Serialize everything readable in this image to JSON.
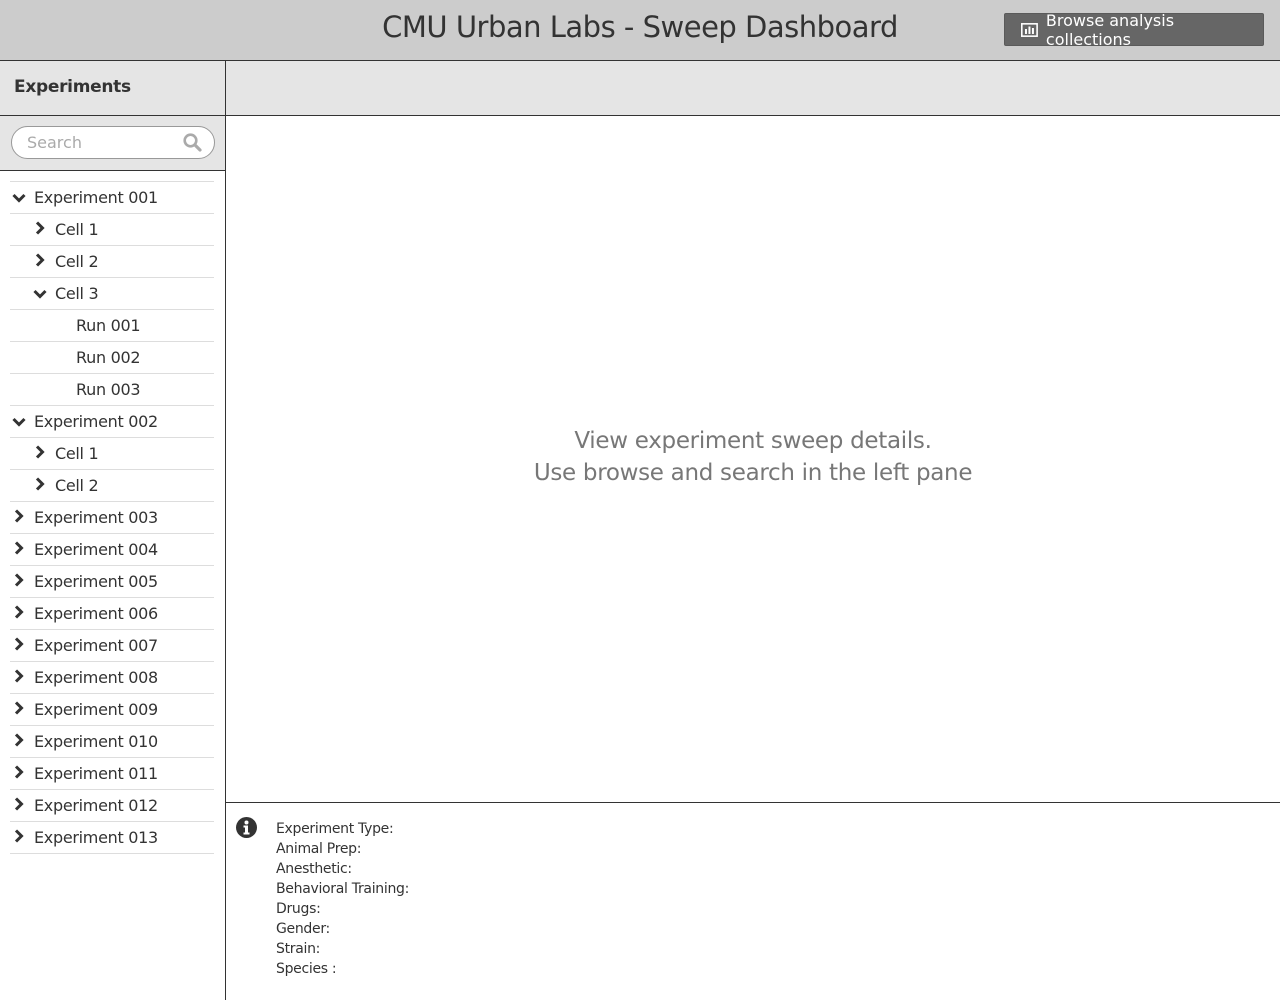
{
  "header": {
    "title": "CMU Urban Labs - Sweep Dashboard",
    "browse_label": "Browse analysis collections"
  },
  "sidebar": {
    "title": "Experiments",
    "search_placeholder": "Search",
    "tree": [
      {
        "label": "Experiment 001",
        "level": 0,
        "state": "expanded"
      },
      {
        "label": "Cell 1",
        "level": 1,
        "state": "collapsed"
      },
      {
        "label": "Cell 2",
        "level": 1,
        "state": "collapsed"
      },
      {
        "label": "Cell 3",
        "level": 1,
        "state": "expanded"
      },
      {
        "label": "Run 001",
        "level": 2,
        "state": "leaf"
      },
      {
        "label": "Run 002",
        "level": 2,
        "state": "leaf"
      },
      {
        "label": "Run 003",
        "level": 2,
        "state": "leaf"
      },
      {
        "label": "Experiment 002",
        "level": 0,
        "state": "expanded"
      },
      {
        "label": "Cell 1",
        "level": 1,
        "state": "collapsed"
      },
      {
        "label": "Cell 2",
        "level": 1,
        "state": "collapsed"
      },
      {
        "label": "Experiment 003",
        "level": 0,
        "state": "collapsed"
      },
      {
        "label": "Experiment 004",
        "level": 0,
        "state": "collapsed"
      },
      {
        "label": "Experiment 005",
        "level": 0,
        "state": "collapsed"
      },
      {
        "label": "Experiment 006",
        "level": 0,
        "state": "collapsed"
      },
      {
        "label": "Experiment 007",
        "level": 0,
        "state": "collapsed"
      },
      {
        "label": "Experiment 008",
        "level": 0,
        "state": "collapsed"
      },
      {
        "label": "Experiment 009",
        "level": 0,
        "state": "collapsed"
      },
      {
        "label": "Experiment 010",
        "level": 0,
        "state": "collapsed"
      },
      {
        "label": "Experiment 011",
        "level": 0,
        "state": "collapsed"
      },
      {
        "label": "Experiment 012",
        "level": 0,
        "state": "collapsed"
      },
      {
        "label": "Experiment 013",
        "level": 0,
        "state": "collapsed"
      }
    ]
  },
  "main": {
    "message_line1": "View experiment sweep details.",
    "message_line2": "Use browse and search in the left pane"
  },
  "info": {
    "fields": [
      "Experiment Type:",
      "Animal Prep:",
      "Anesthetic:",
      "Behavioral Training:",
      "Drugs:",
      "Gender:",
      "Strain:",
      "Species :"
    ]
  }
}
